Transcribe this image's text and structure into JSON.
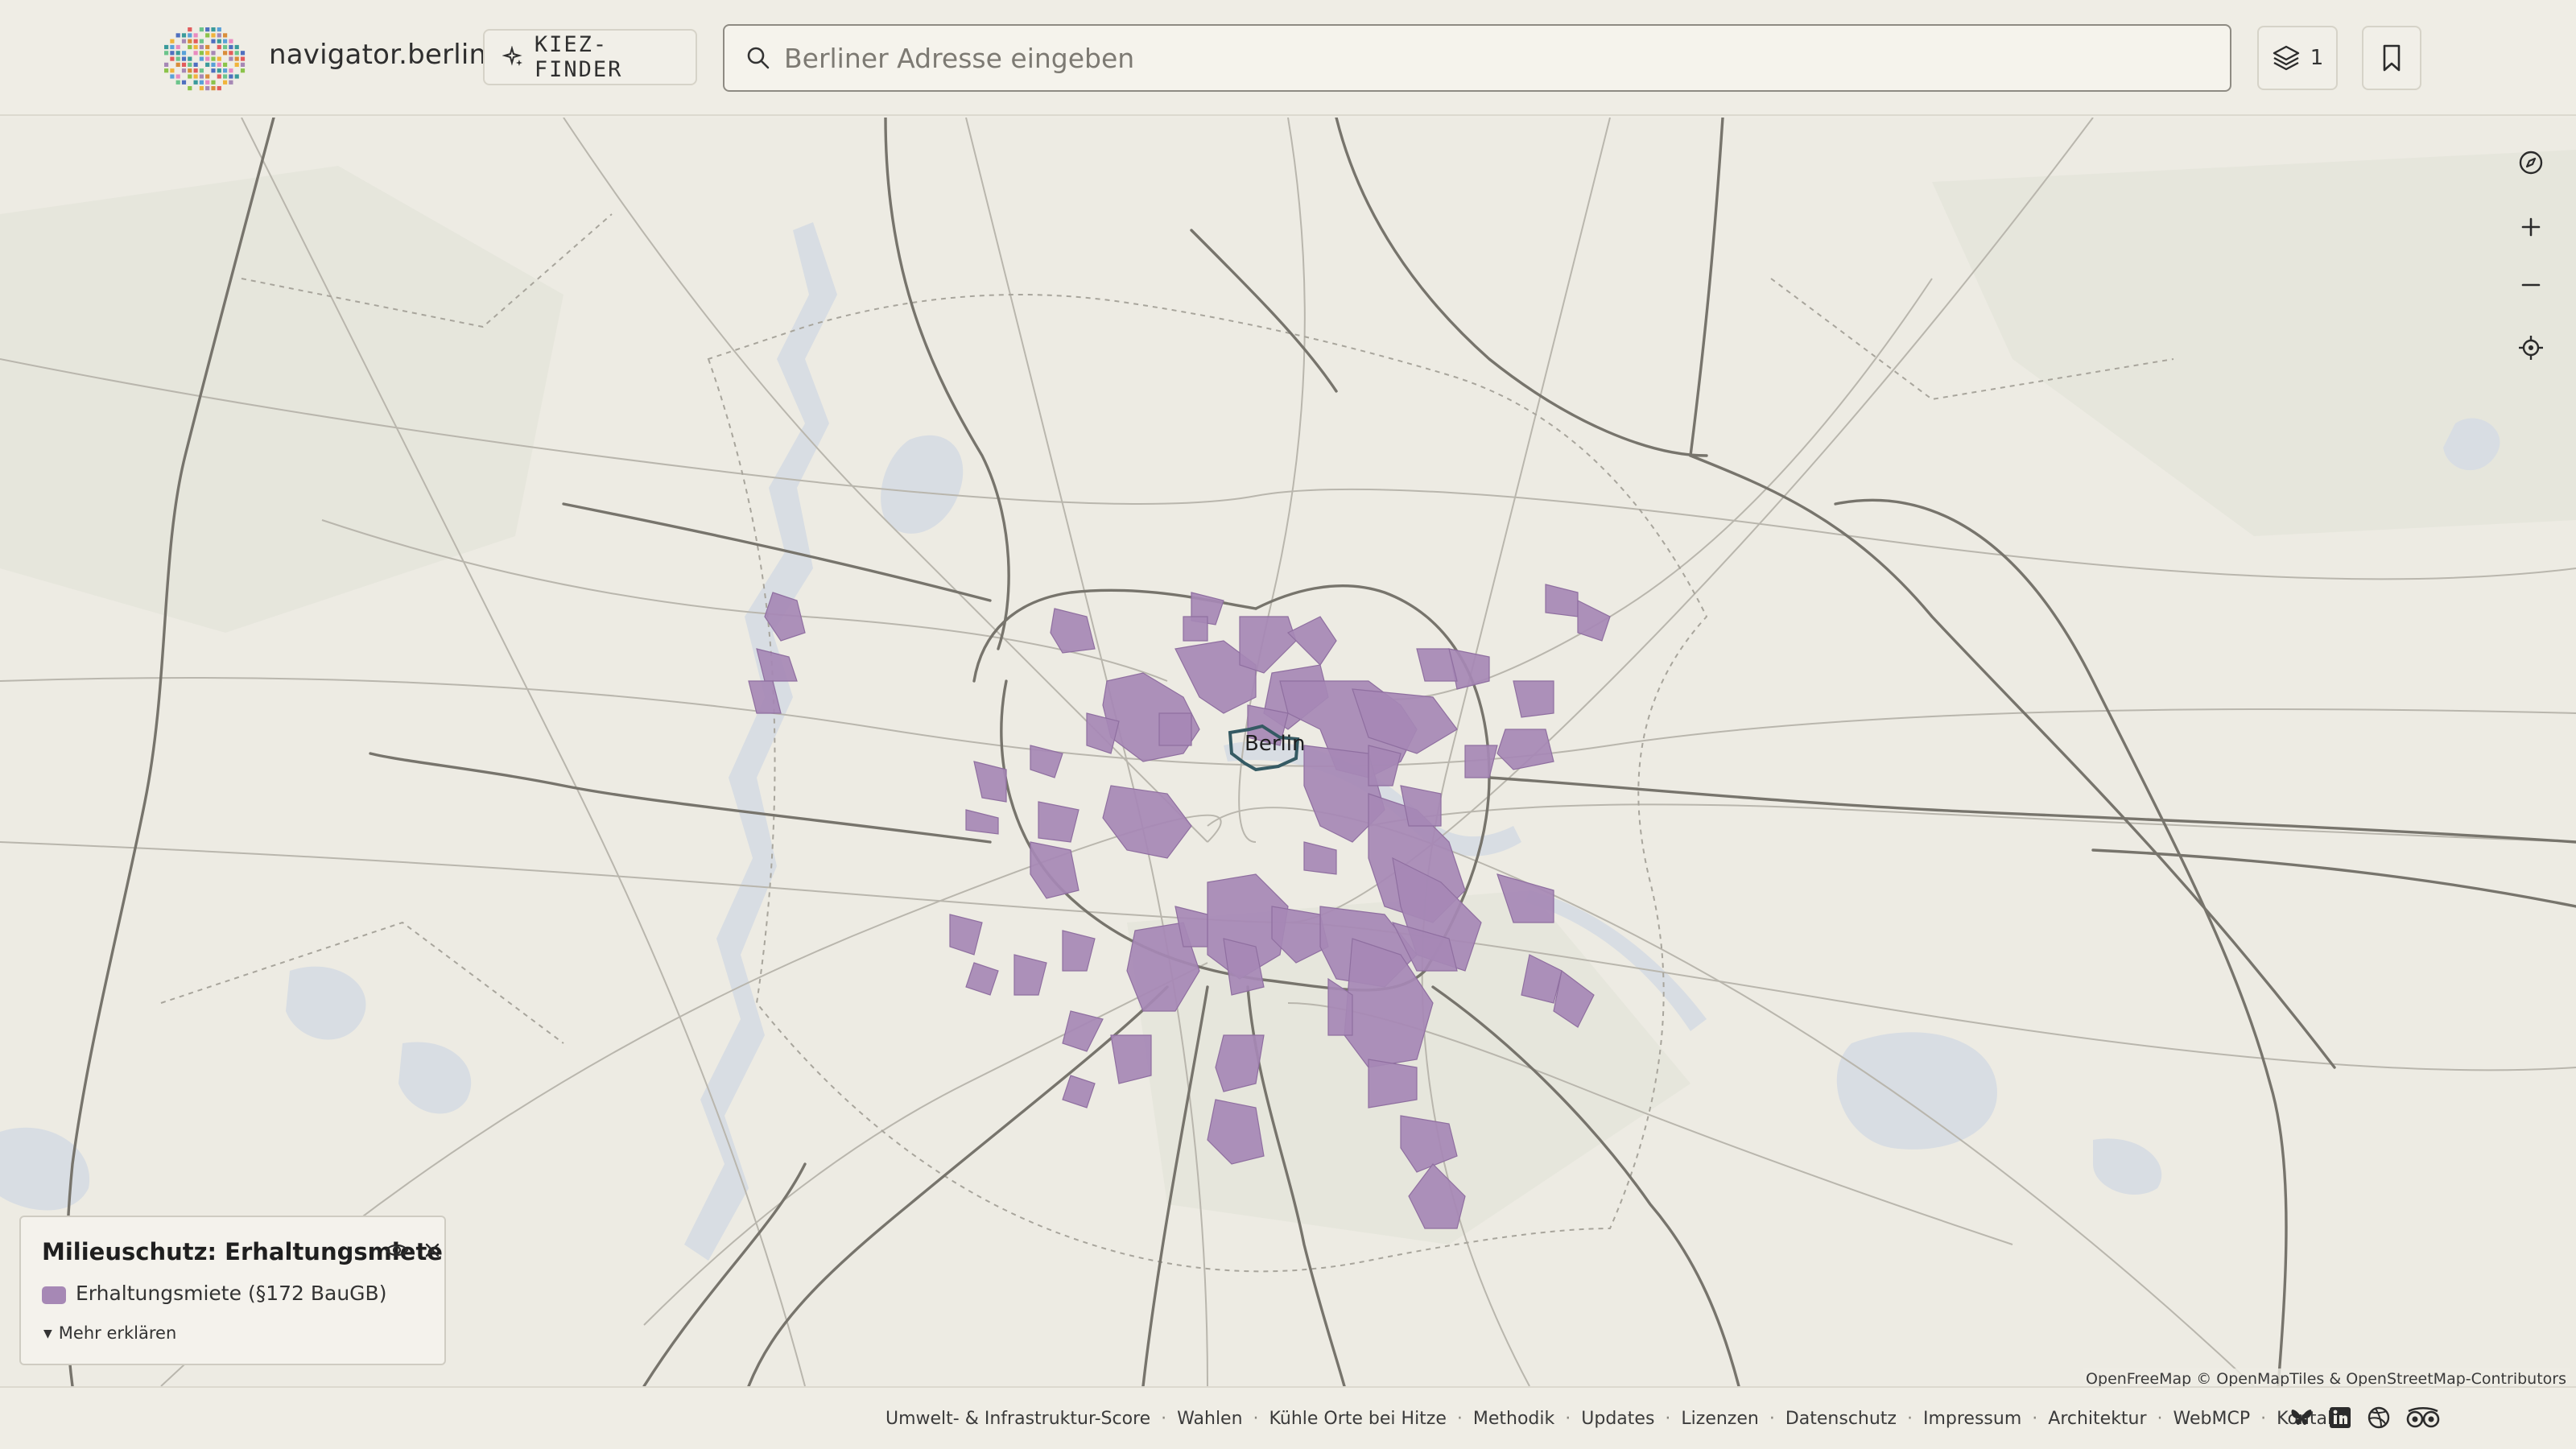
{
  "header": {
    "brand": "navigator.berlin",
    "kiez_finder_label": "KIEZ-FINDER",
    "search_placeholder": "Berliner Adresse eingeben",
    "layers_count": "1"
  },
  "map": {
    "city_label": "Berlin",
    "highlight_color": "#a688b5",
    "controls": [
      "compass-icon",
      "zoom-in-icon",
      "zoom-out-icon",
      "locate-icon"
    ],
    "attribution": "OpenFreeMap © OpenMapTiles & OpenStreetMap-Contributors"
  },
  "legend": {
    "title": "Milieuschutz: Erhaltungsmiete",
    "item_label": "Erhaltungsmiete (§172 BauGB)",
    "more_label": "Mehr erklären",
    "swatch_color": "#a688b5"
  },
  "footer": {
    "links": [
      "Umwelt- & Infrastruktur-Score",
      "Wahlen",
      "Kühle Orte bei Hitze",
      "Methodik",
      "Updates",
      "Lizenzen",
      "Datenschutz",
      "Impressum",
      "Architektur",
      "WebMCP",
      "Kontakt"
    ],
    "social": [
      "bluesky-icon",
      "linkedin-icon",
      "dribbble-icon",
      "tripadvisor-icon"
    ]
  }
}
